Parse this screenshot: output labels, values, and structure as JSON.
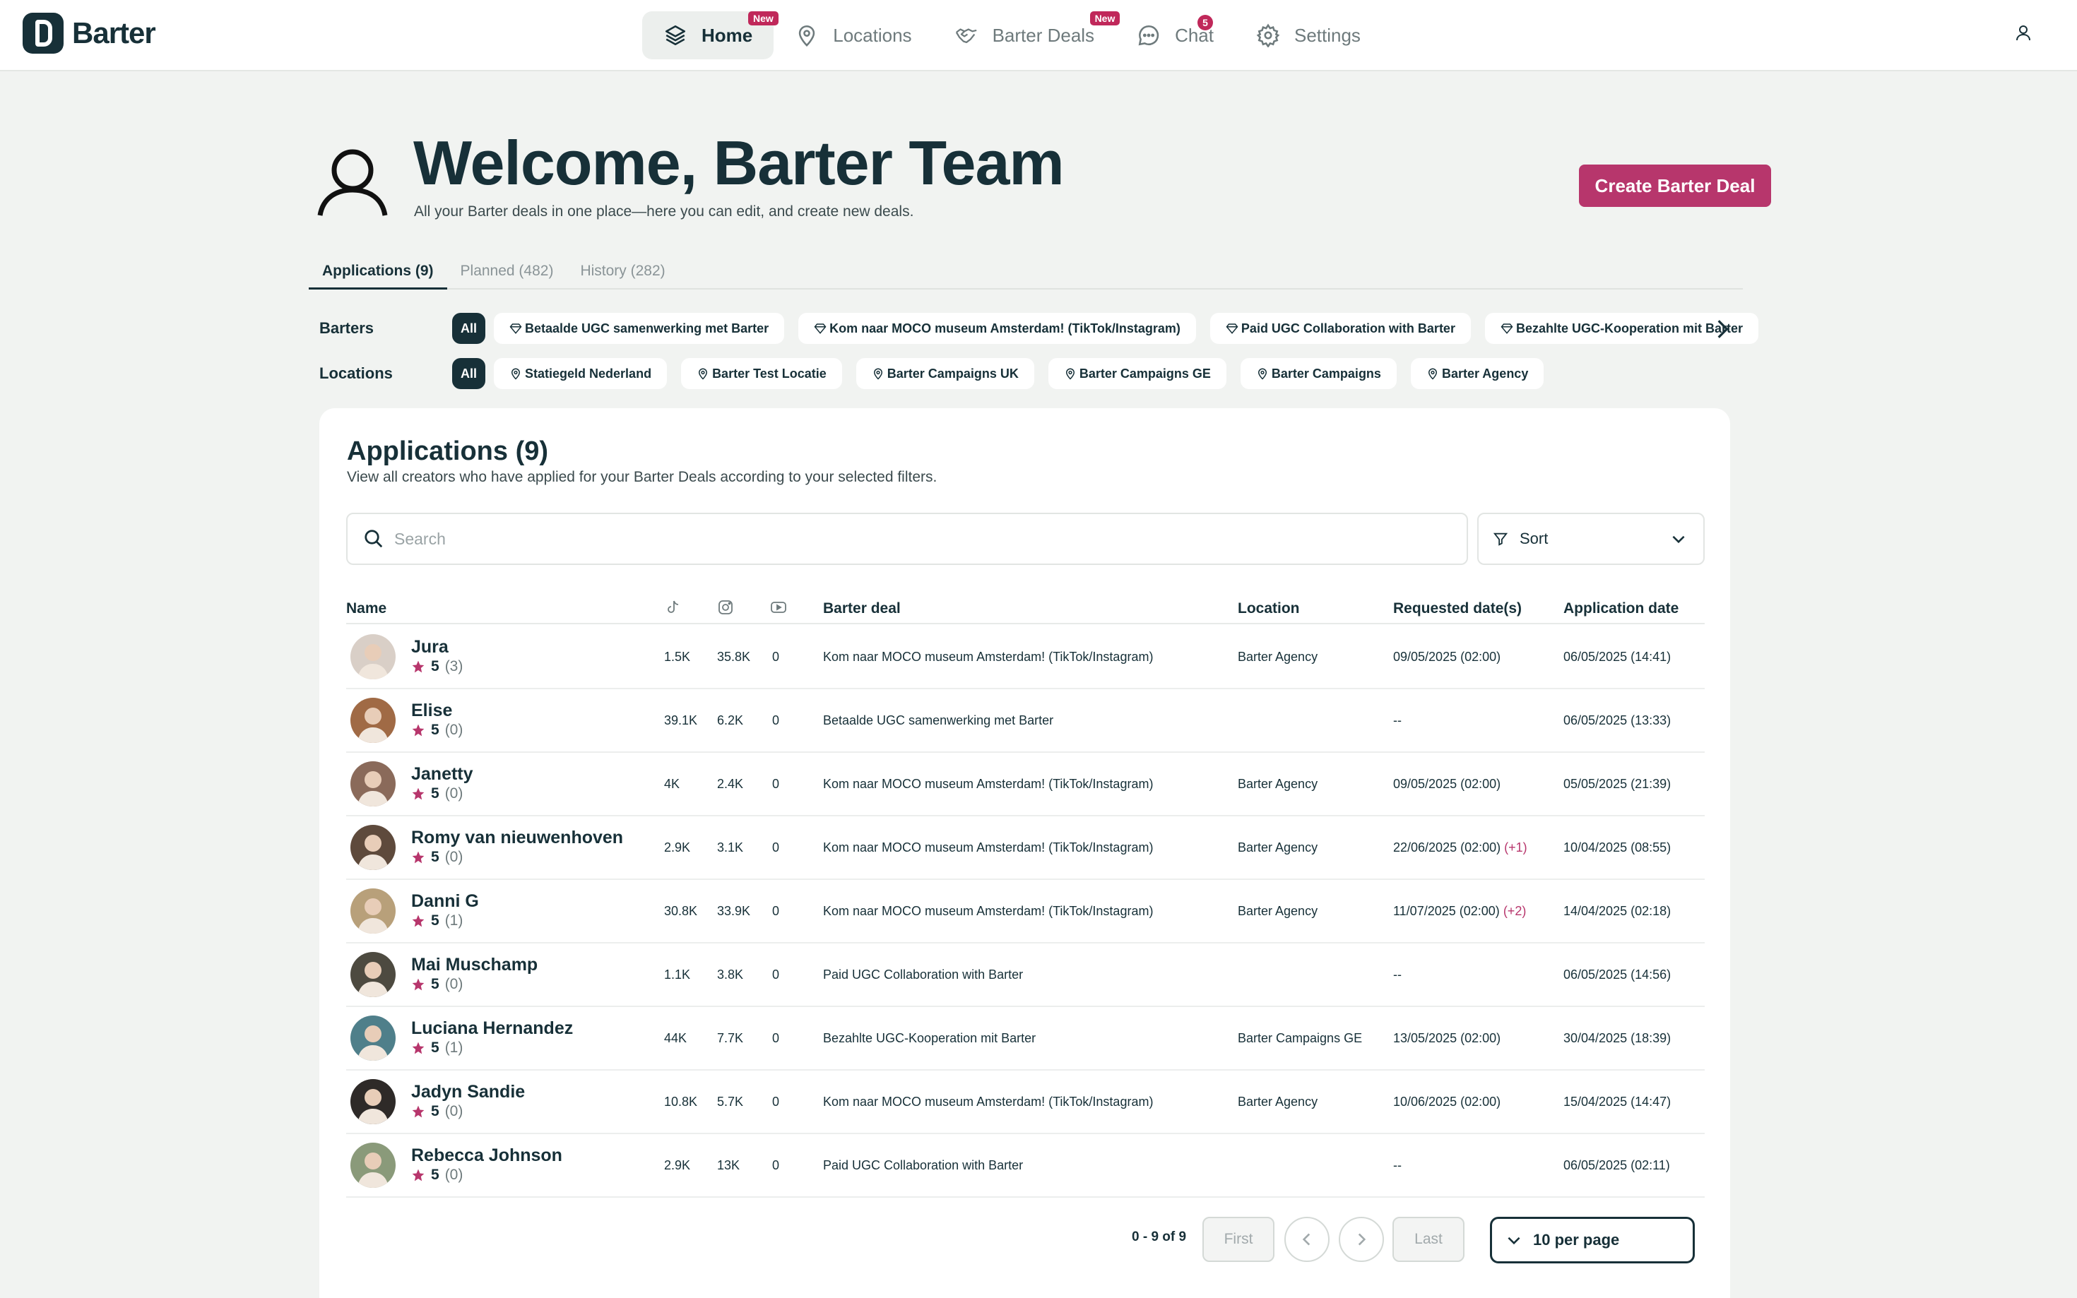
{
  "app": {
    "name": "Barter"
  },
  "nav": {
    "items": [
      {
        "label": "Home",
        "icon": "layers-icon",
        "badge": "New",
        "active": true
      },
      {
        "label": "Locations",
        "icon": "map-pin-icon",
        "badge": ""
      },
      {
        "label": "Barter Deals",
        "icon": "handshake-icon",
        "badge": "New"
      },
      {
        "label": "Chat",
        "icon": "chat-bubble-icon",
        "badge": "5"
      },
      {
        "label": "Settings",
        "icon": "gear-icon",
        "badge": ""
      }
    ]
  },
  "hero": {
    "title": "Welcome, Barter Team",
    "subtitle": "All your Barter deals in one place—here you can edit, and create new deals.",
    "create_label": "Create Barter Deal"
  },
  "tabs": [
    {
      "label": "Applications (9)",
      "active": true
    },
    {
      "label": "Planned (482)",
      "active": false
    },
    {
      "label": "History (282)",
      "active": false
    }
  ],
  "filters": {
    "barters_label": "Barters",
    "locations_label": "Locations",
    "all_label": "All",
    "barters": [
      "Betaalde UGC samenwerking met Barter",
      "Kom naar MOCO museum Amsterdam! (TikTok/Instagram)",
      "Paid UGC Collaboration with Barter",
      "Bezahlte UGC-Kooperation mit Barter"
    ],
    "locations": [
      "Statiegeld Nederland",
      "Barter Test Locatie",
      "Barter Campaigns UK",
      "Barter Campaigns GE",
      "Barter Campaigns",
      "Barter Agency"
    ]
  },
  "applications": {
    "title": "Applications (9)",
    "subtitle": "View all creators who have applied for your Barter Deals according to your selected filters.",
    "search_placeholder": "Search",
    "sort_label": "Sort",
    "columns": {
      "name": "Name",
      "tiktok": "tiktok-icon",
      "instagram": "instagram-icon",
      "youtube": "youtube-icon",
      "deal": "Barter deal",
      "location": "Location",
      "requested": "Requested date(s)",
      "applied": "Application date"
    },
    "rows": [
      {
        "name": "Jura",
        "rating": "5",
        "reviews": "(3)",
        "tiktok": "1.5K",
        "instagram": "35.8K",
        "youtube": "0",
        "deal": "Kom naar MOCO museum Amsterdam! (TikTok/Instagram)",
        "location": "Barter Agency",
        "requested": "09/05/2025 (02:00)",
        "requested_extra": "",
        "applied": "06/05/2025 (14:41)",
        "avatar_color": "#d9cfc7"
      },
      {
        "name": "Elise",
        "rating": "5",
        "reviews": "(0)",
        "tiktok": "39.1K",
        "instagram": "6.2K",
        "youtube": "0",
        "deal": "Betaalde UGC samenwerking met Barter",
        "location": "",
        "requested": "--",
        "requested_extra": "",
        "applied": "06/05/2025 (13:33)",
        "avatar_color": "#a06a45"
      },
      {
        "name": "Janetty",
        "rating": "5",
        "reviews": "(0)",
        "tiktok": "4K",
        "instagram": "2.4K",
        "youtube": "0",
        "deal": "Kom naar MOCO museum Amsterdam! (TikTok/Instagram)",
        "location": "Barter Agency",
        "requested": "09/05/2025 (02:00)",
        "requested_extra": "",
        "applied": "05/05/2025 (21:39)",
        "avatar_color": "#8a6a5a"
      },
      {
        "name": "Romy van nieuwenhoven",
        "rating": "5",
        "reviews": "(0)",
        "tiktok": "2.9K",
        "instagram": "3.1K",
        "youtube": "0",
        "deal": "Kom naar MOCO museum Amsterdam! (TikTok/Instagram)",
        "location": "Barter Agency",
        "requested": "22/06/2025 (02:00)",
        "requested_extra": "(+1)",
        "applied": "10/04/2025 (08:55)",
        "avatar_color": "#5e4a3c"
      },
      {
        "name": "Danni G",
        "rating": "5",
        "reviews": "(1)",
        "tiktok": "30.8K",
        "instagram": "33.9K",
        "youtube": "0",
        "deal": "Kom naar MOCO museum Amsterdam! (TikTok/Instagram)",
        "location": "Barter Agency",
        "requested": "11/07/2025 (02:00)",
        "requested_extra": "(+2)",
        "applied": "14/04/2025 (02:18)",
        "avatar_color": "#b8a07a"
      },
      {
        "name": "Mai Muschamp",
        "rating": "5",
        "reviews": "(0)",
        "tiktok": "1.1K",
        "instagram": "3.8K",
        "youtube": "0",
        "deal": "Paid UGC Collaboration with Barter",
        "location": "",
        "requested": "--",
        "requested_extra": "",
        "applied": "06/05/2025 (14:56)",
        "avatar_color": "#4d4a40"
      },
      {
        "name": "Luciana Hernandez",
        "rating": "5",
        "reviews": "(1)",
        "tiktok": "44K",
        "instagram": "7.7K",
        "youtube": "0",
        "deal": "Bezahlte UGC-Kooperation mit Barter",
        "location": "Barter Campaigns GE",
        "requested": "13/05/2025 (02:00)",
        "requested_extra": "",
        "applied": "30/04/2025 (18:39)",
        "avatar_color": "#4f7f8a"
      },
      {
        "name": "Jadyn Sandie",
        "rating": "5",
        "reviews": "(0)",
        "tiktok": "10.8K",
        "instagram": "5.7K",
        "youtube": "0",
        "deal": "Kom naar MOCO museum Amsterdam! (TikTok/Instagram)",
        "location": "Barter Agency",
        "requested": "10/06/2025 (02:00)",
        "requested_extra": "",
        "applied": "15/04/2025 (14:47)",
        "avatar_color": "#2e2a28"
      },
      {
        "name": "Rebecca Johnson",
        "rating": "5",
        "reviews": "(0)",
        "tiktok": "2.9K",
        "instagram": "13K",
        "youtube": "0",
        "deal": "Paid UGC Collaboration with Barter",
        "location": "",
        "requested": "--",
        "requested_extra": "",
        "applied": "06/05/2025 (02:11)",
        "avatar_color": "#8a9a7a"
      }
    ]
  },
  "pagination": {
    "info": "0 - 9 of 9",
    "first_label": "First",
    "last_label": "Last",
    "per_page": "10 per page"
  },
  "colors": {
    "accent": "#b7366c",
    "primary": "#173038",
    "background": "#f1f3f1"
  }
}
